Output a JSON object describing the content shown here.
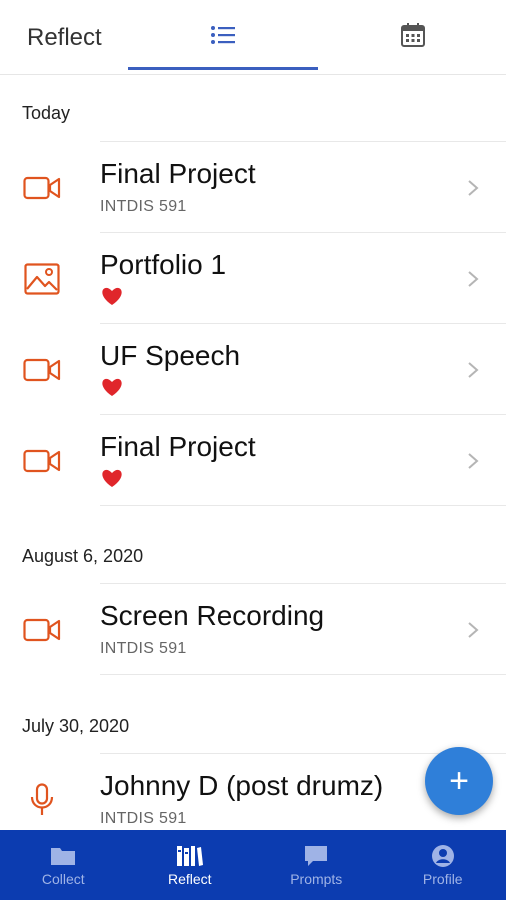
{
  "header": {
    "title": "Reflect",
    "tabs": [
      {
        "name": "list-view",
        "icon": "list-icon",
        "active": true
      },
      {
        "name": "calendar-view",
        "icon": "calendar-icon",
        "active": false
      }
    ]
  },
  "sections": [
    {
      "date": "Today",
      "items": [
        {
          "title": "Final Project",
          "subtitle": "INTDIS 591",
          "icon": "video-icon"
        },
        {
          "title": "Portfolio 1",
          "subtitle": "",
          "icon": "image-icon",
          "favorite": true
        },
        {
          "title": "UF Speech",
          "subtitle": "",
          "icon": "video-icon",
          "favorite": true
        },
        {
          "title": "Final Project",
          "subtitle": "",
          "icon": "video-icon",
          "favorite": true
        }
      ]
    },
    {
      "date": "August 6, 2020",
      "items": [
        {
          "title": "Screen Recording",
          "subtitle": "INTDIS 591",
          "icon": "video-icon"
        }
      ]
    },
    {
      "date": "July 30, 2020",
      "items": [
        {
          "title": "Johnny D (post drumz)",
          "subtitle": "INTDIS 591",
          "icon": "microphone-icon"
        }
      ]
    }
  ],
  "fab": {
    "label": "+",
    "icon": "plus-icon"
  },
  "bottom_nav": [
    {
      "label": "Collect",
      "icon": "folder-icon",
      "active": false
    },
    {
      "label": "Reflect",
      "icon": "books-icon",
      "active": true
    },
    {
      "label": "Prompts",
      "icon": "chat-bubble-icon",
      "active": false
    },
    {
      "label": "Profile",
      "icon": "user-circle-icon",
      "active": false
    }
  ],
  "colors": {
    "accent_orange": "#e0541f",
    "tab_indicator": "#3b5fbf",
    "nav_background": "#0c3cb0",
    "fab": "#2f7fd9",
    "heart": "#e0262b"
  }
}
